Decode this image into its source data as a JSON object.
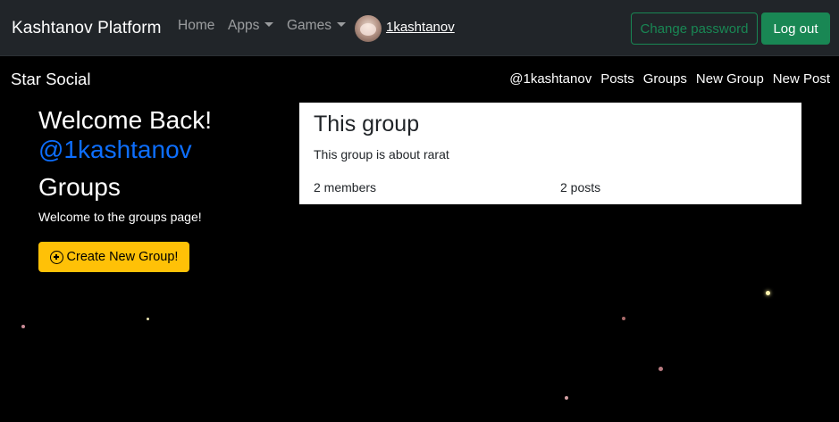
{
  "navbar": {
    "brand": "Kashtanov Platform",
    "links": {
      "home": "Home",
      "apps": "Apps",
      "games": "Games"
    },
    "username": "1kashtanov",
    "change_password": "Change password",
    "logout": "Log out"
  },
  "site": {
    "title": "Star Social",
    "links": [
      "@1kashtanov",
      "Posts",
      "Groups",
      "New Group",
      "New Post"
    ]
  },
  "sidebar": {
    "welcome": "Welcome Back!",
    "handle": "@1kashtanov",
    "heading": "Groups",
    "text": "Welcome to the groups page!",
    "create_button": "Create New Group!"
  },
  "group": {
    "title": "This group",
    "description": "This group is about rarat",
    "members": "2 members",
    "posts": "2 posts"
  },
  "colors": {
    "navbar_bg": "#212529",
    "success": "#198754",
    "primary": "#0d6efd",
    "warning": "#ffc107",
    "background": "#000000"
  }
}
